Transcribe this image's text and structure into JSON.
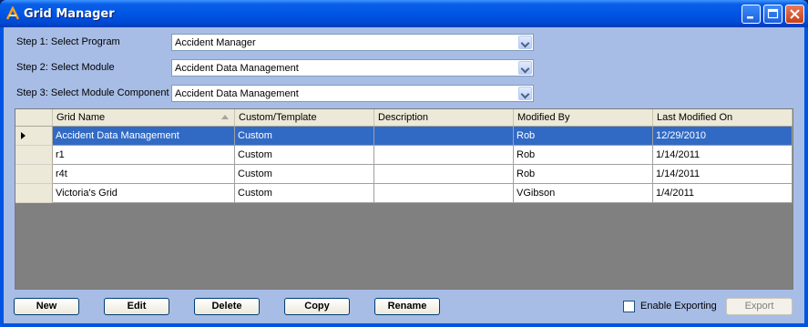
{
  "window": {
    "title": "Grid Manager"
  },
  "steps": [
    {
      "label": "Step 1: Select Program",
      "value": "Accident Manager"
    },
    {
      "label": "Step 2: Select Module",
      "value": "Accident Data Management"
    },
    {
      "label": "Step 3: Select Module Component",
      "value": "Accident Data Management"
    }
  ],
  "grid": {
    "columns": [
      "Grid Name",
      "Custom/Template",
      "Description",
      "Modified By",
      "Last Modified On"
    ],
    "sorted_column": "Grid Name",
    "rows": [
      {
        "name": "Accident Data Management",
        "type": "Custom",
        "description": "",
        "modified_by": "Rob",
        "last_modified": "12/29/2010"
      },
      {
        "name": "r1",
        "type": "Custom",
        "description": "",
        "modified_by": "Rob",
        "last_modified": "1/14/2011"
      },
      {
        "name": "r4t",
        "type": "Custom",
        "description": "",
        "modified_by": "Rob",
        "last_modified": "1/14/2011"
      },
      {
        "name": "Victoria's Grid",
        "type": "Custom",
        "description": "",
        "modified_by": "VGibson",
        "last_modified": "1/4/2011"
      }
    ],
    "selected_row": 0
  },
  "buttons": {
    "new": "New",
    "edit": "Edit",
    "delete": "Delete",
    "copy": "Copy",
    "rename": "Rename",
    "export": "Export"
  },
  "enable_exporting": {
    "label": "Enable Exporting",
    "checked": false
  },
  "colors": {
    "title_bar": "#0054e3",
    "client_bg": "#a7bde6",
    "selection": "#316ac5",
    "grid_empty": "#808080"
  }
}
